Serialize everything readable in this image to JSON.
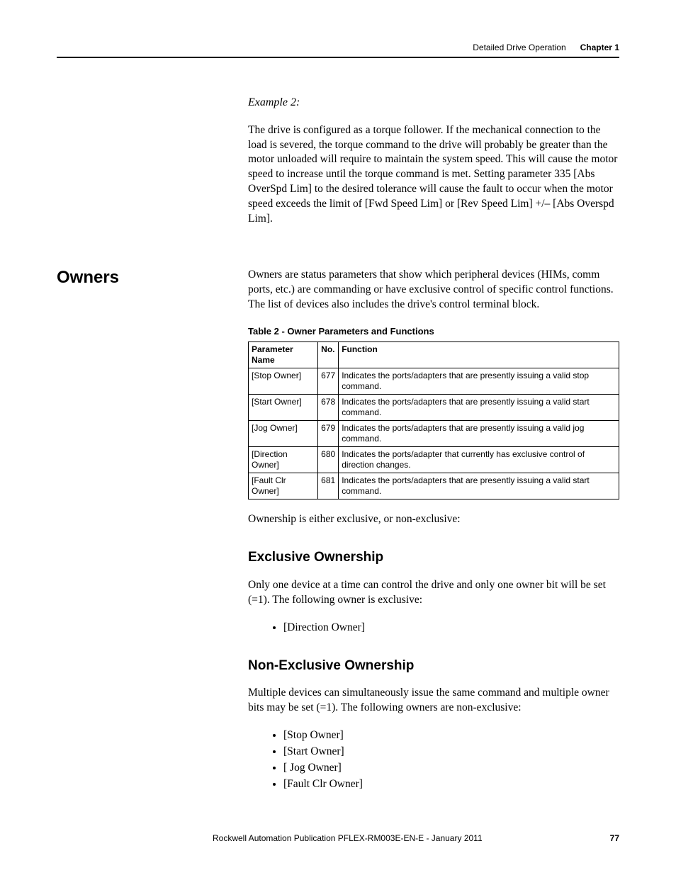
{
  "header": {
    "section": "Detailed Drive Operation",
    "chapter": "Chapter 1"
  },
  "example": {
    "label": "Example 2:",
    "text": "The drive is configured as a torque follower. If the mechanical connection to the load is severed, the torque command to the drive will probably be greater than the motor unloaded will require to maintain the system speed. This will cause the motor speed to increase until the torque command is met. Setting parameter 335 [Abs OverSpd Lim] to the desired tolerance will cause the fault to occur when the motor speed exceeds the limit of [Fwd Speed Lim] or [Rev Speed Lim] +/– [Abs Overspd Lim]."
  },
  "owners": {
    "heading": "Owners",
    "intro": "Owners are status parameters that show which peripheral devices (HIMs, comm ports, etc.) are commanding or have exclusive control of specific control functions. The list of devices also includes the drive's control terminal block.",
    "table_caption": "Table 2 - Owner Parameters and Functions",
    "columns": {
      "c1": "Parameter Name",
      "c2": "No.",
      "c3": "Function"
    },
    "rows": [
      {
        "name": "[Stop Owner]",
        "no": "677",
        "fn": "Indicates the ports/adapters that are presently issuing a valid stop command."
      },
      {
        "name": "[Start Owner]",
        "no": "678",
        "fn": "Indicates the ports/adapters that are presently issuing a valid start command."
      },
      {
        "name": "[Jog Owner]",
        "no": "679",
        "fn": "Indicates the ports/adapters that are presently issuing a valid jog command."
      },
      {
        "name": "[Direction Owner]",
        "no": "680",
        "fn": "Indicates the ports/adapter that currently has exclusive control of direction changes."
      },
      {
        "name": "[Fault Clr Owner]",
        "no": "681",
        "fn": "Indicates the ports/adapters that are presently issuing a valid start command."
      }
    ],
    "after_table": "Ownership is either exclusive, or non-exclusive:"
  },
  "exclusive": {
    "heading": "Exclusive Ownership",
    "text": "Only one device at a time can control the drive and only one owner bit will be set (=1). The following owner is exclusive:",
    "items": [
      "[Direction Owner]"
    ]
  },
  "nonexclusive": {
    "heading": "Non-Exclusive Ownership",
    "text": "Multiple devices can simultaneously issue the same command and multiple owner bits may be set (=1). The following owners are non-exclusive:",
    "items": [
      "[Stop Owner]",
      "[Start Owner]",
      "[ Jog Owner]",
      "[Fault Clr Owner]"
    ]
  },
  "footer": {
    "pub": "Rockwell Automation Publication PFLEX-RM003E-EN-E - January 2011",
    "page": "77"
  }
}
